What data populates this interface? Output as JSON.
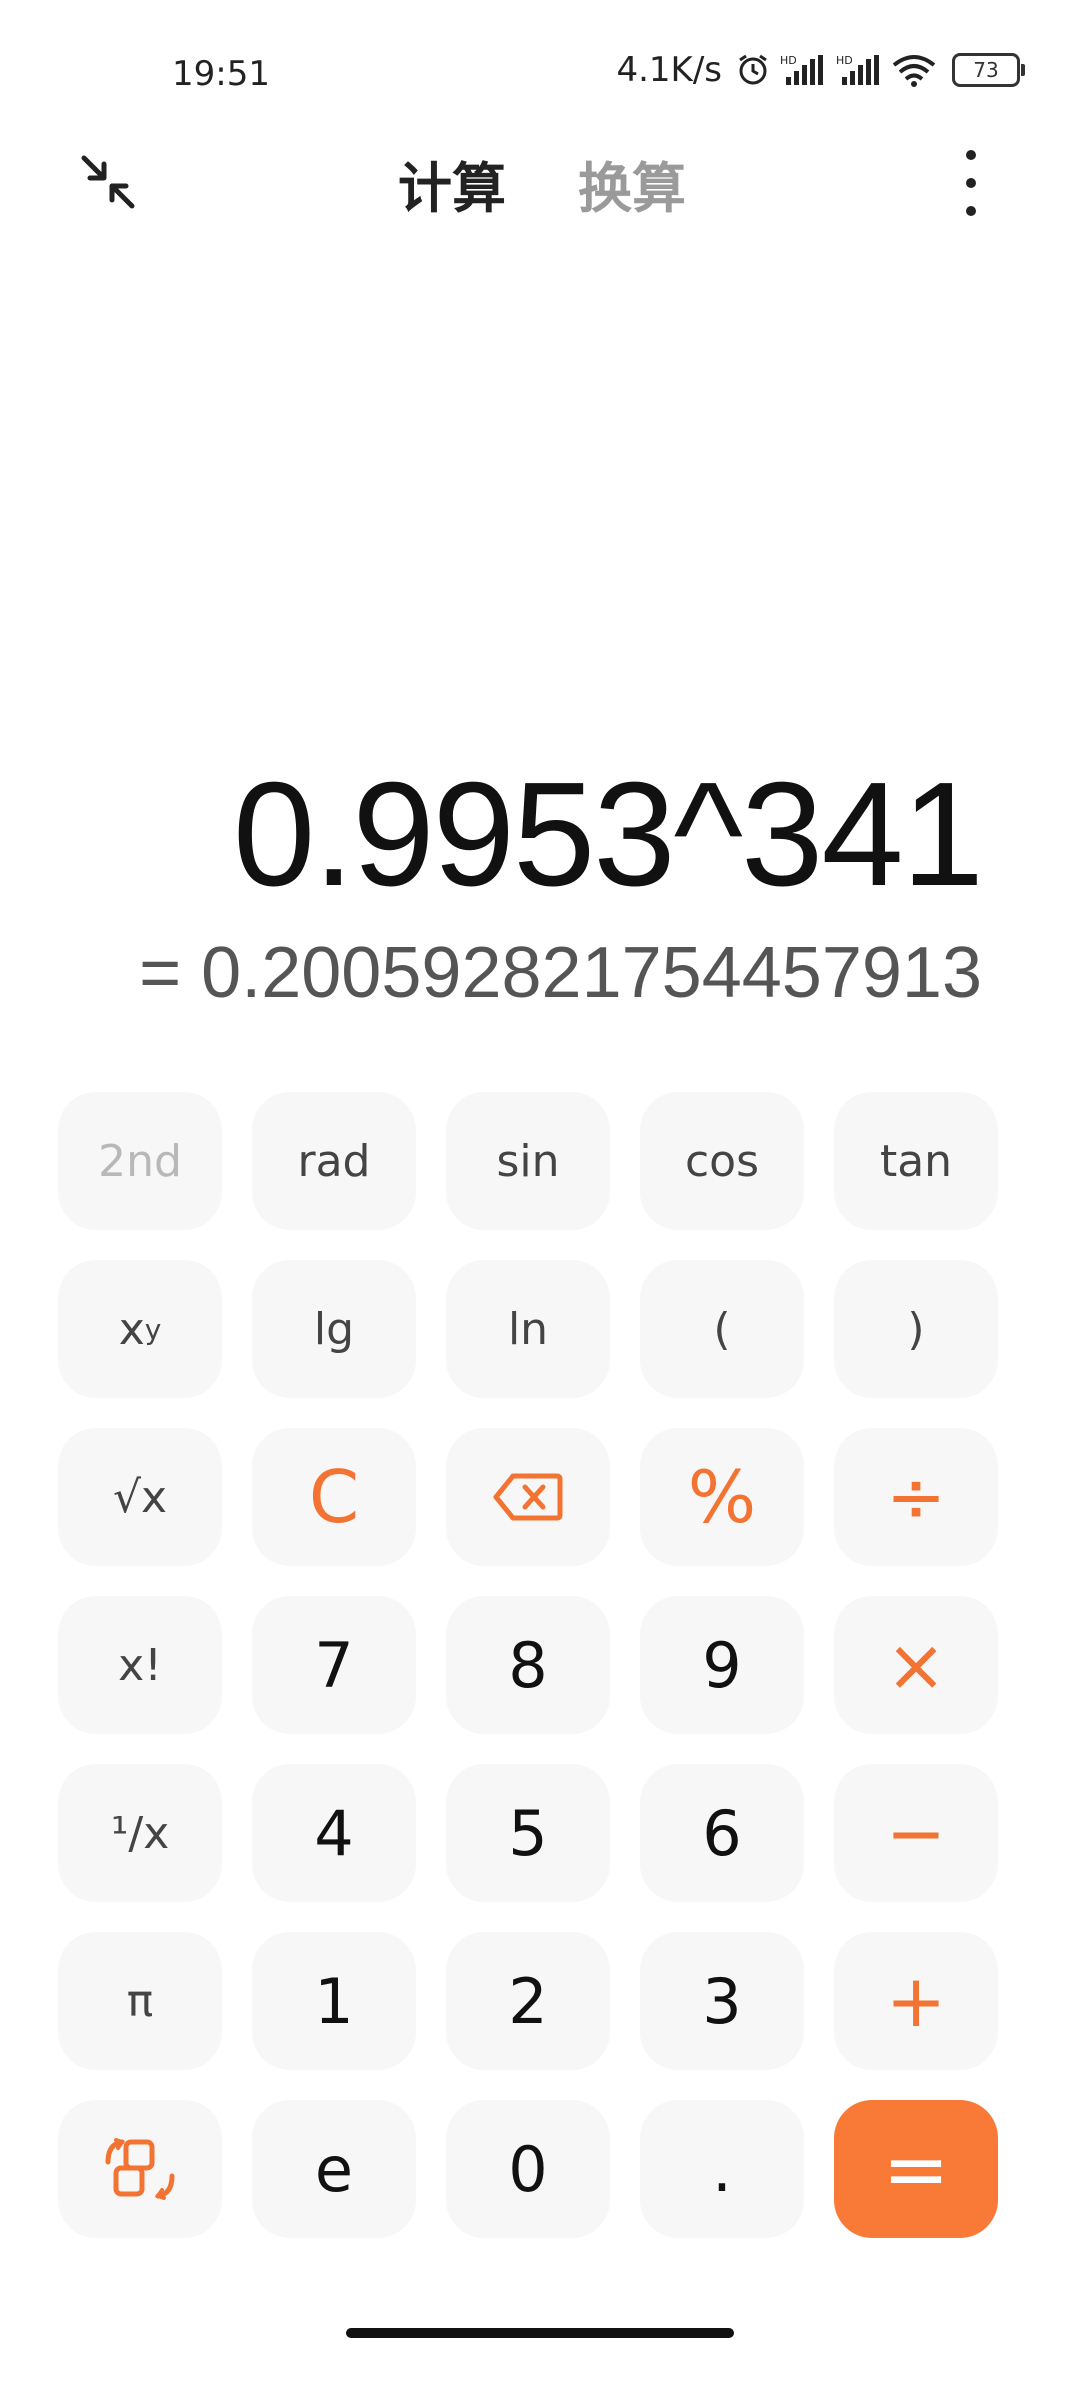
{
  "status_bar": {
    "time": "19:51",
    "net_speed": "4.1K/s",
    "battery": "73",
    "icons": [
      "alarm-icon",
      "hd-signal-icon",
      "hd-signal-icon",
      "wifi-icon",
      "battery-icon"
    ]
  },
  "header": {
    "tabs": [
      {
        "label": "计算",
        "active": true
      },
      {
        "label": "换算",
        "active": false
      }
    ]
  },
  "display": {
    "expression": "0.9953^341",
    "result": "= 0.200592821754457913"
  },
  "keys": {
    "second": "2nd",
    "rad": "rad",
    "sin": "sin",
    "cos": "cos",
    "tan": "tan",
    "pow_base": "x",
    "pow_exp": "y",
    "lg": "lg",
    "ln": "ln",
    "lparen": "(",
    "rparen": ")",
    "sqrt": "√x",
    "clear": "C",
    "percent": "%",
    "divide": "÷",
    "factorial": "x!",
    "seven": "7",
    "eight": "8",
    "nine": "9",
    "multiply": "×",
    "reciprocal": "¹/x",
    "four": "4",
    "five": "5",
    "six": "6",
    "minus": "−",
    "pi": "π",
    "one": "1",
    "two": "2",
    "three": "3",
    "plus": "+",
    "e": "e",
    "zero": "0",
    "dot": ".",
    "equals": "="
  },
  "colors": {
    "accent": "#f27332",
    "equals_bg": "#f97a37",
    "key_bg": "#f7f7f7"
  }
}
